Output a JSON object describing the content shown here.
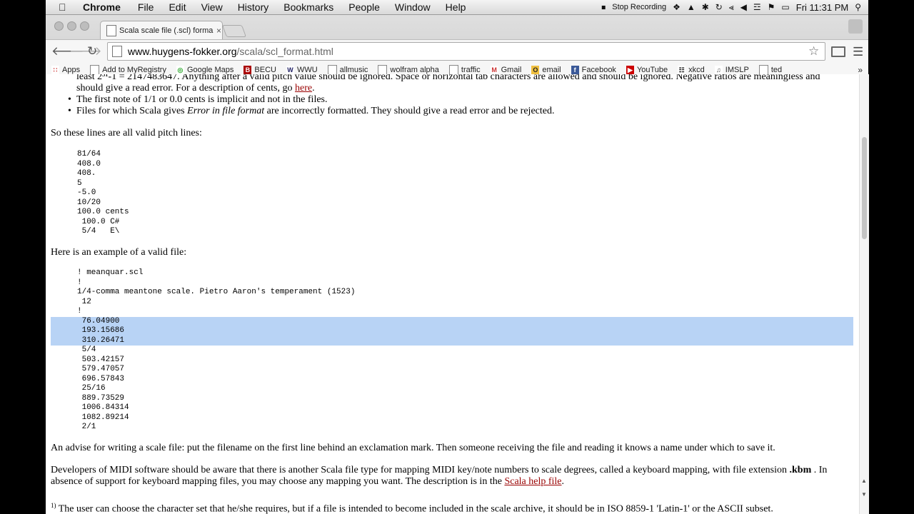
{
  "menubar": {
    "app": "Chrome",
    "menus": [
      "File",
      "Edit",
      "View",
      "History",
      "Bookmarks",
      "People",
      "Window",
      "Help"
    ],
    "status": "Stop Recording",
    "clock": "Fri 11:31 PM"
  },
  "tab": {
    "title": "Scala scale file (.scl) forma",
    "close": "×"
  },
  "omnibox": {
    "host": "www.huygens-fokker.org",
    "path": "/scala/scl_format.html"
  },
  "bookmarks": [
    "Apps",
    "Add to MyRegistry",
    "Google Maps",
    "BECU",
    "WWU",
    "allmusic",
    "wolfram alpha",
    "traffic",
    "Gmail",
    "email",
    "Facebook",
    "YouTube",
    "xkcd",
    "IMSLP",
    "ted"
  ],
  "page": {
    "top_line1": "least 2³¹-1 = 2147483647. Anything after a valid pitch value should be ignored. Space or horizontal tab characters are allowed and should be ignored. Negative ratios are meaningless and",
    "top_line2_pre": "should give a read error. For a description of cents, go ",
    "top_line2_link": "here",
    "top_line2_post": ".",
    "bullet1": "The first note of 1/1 or 0.0 cents is implicit and not in the files.",
    "bullet2_pre": "Files for which Scala gives ",
    "bullet2_em": "Error in file format",
    "bullet2_post": " are incorrectly formatted. They should give a read error and be rejected.",
    "valid_lines_intro": "So these lines are all valid pitch lines:",
    "valid_lines": [
      "81/64",
      "408.0",
      "408.",
      "5",
      "-5.0",
      "10/20",
      "100.0 cents",
      " 100.0 C#",
      " 5/4   E\\"
    ],
    "example_intro": "Here is an example of a valid file:",
    "example_lines": [
      "! meanquar.scl",
      "!",
      "1/4-comma meantone scale. Pietro Aaron's temperament (1523)",
      " 12",
      "!",
      " 76.04900",
      " 193.15686",
      " 310.26471",
      " 5/4",
      " 503.42157",
      " 579.47057",
      " 696.57843",
      " 25/16",
      " 889.73529",
      " 1006.84314",
      " 1082.89214",
      " 2/1"
    ],
    "advise": "An advise for writing a scale file: put the filename on the first line behind an exclamation mark. Then someone receiving the file and reading it knows a name under which to save it.",
    "midi_line1_pre": "Developers of MIDI software should be aware that there is another Scala file type for mapping MIDI key/note numbers to scale degrees, called a keyboard mapping, with file extension ",
    "midi_kbm": ".kbm",
    "midi_line1_post": " . In",
    "midi_line2_pre": "absence of support for keyboard mapping files, you may choose any mapping you want. The description is in the ",
    "midi_link": "Scala help file",
    "midi_line2_post": ".",
    "footnote_mark": "1)",
    "footnote": " The user can choose the character set that he/she requires, but if a file is intended to become included in the scale archive, it should be in ISO 8859-1 'Latin-1' or the ASCII subset."
  },
  "colors": {
    "selection": "#b8d3f5",
    "link": "#990000"
  }
}
